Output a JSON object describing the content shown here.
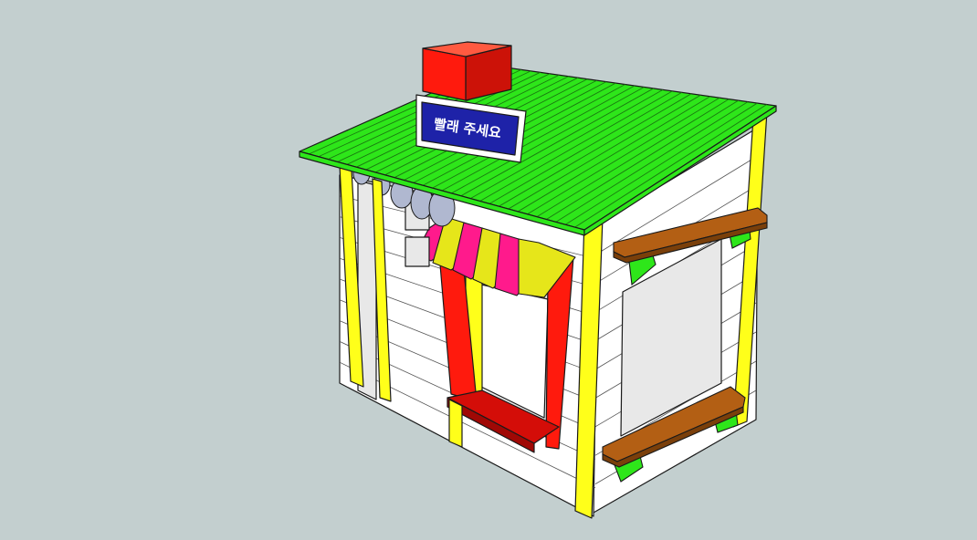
{
  "scene": {
    "background_color": "#c3cfcf",
    "outline_color": "#1a1a1a"
  },
  "roof": {
    "color": "#2ee61a",
    "plank_line_color": "#1a7a10"
  },
  "chimney": {
    "front_color": "#ff1a0d",
    "side_color": "#cc1208",
    "top_color": "#ff5a40"
  },
  "sign": {
    "board_color": "#ffffff",
    "panel_color": "#1e22a8",
    "text": "빨래 주세요",
    "text_color": "#ffffff"
  },
  "walls": {
    "color": "#ffffff",
    "shade_color": "#e8e8e8",
    "line_color": "#555555"
  },
  "posts": {
    "color": "#ffff1a"
  },
  "window": {
    "frame_red": "#ff1a0d",
    "frame_yellow": "#ffff1a",
    "counter_color": "#d40d08",
    "counter_edge_color": "#a00805"
  },
  "awning": {
    "stripe_colors": [
      "#ff1a8c",
      "#e6e61a"
    ]
  },
  "shelves": {
    "top_color": "#b35f14",
    "edge_color": "#7a3f0a",
    "bracket_color": "#2ee61a"
  },
  "plates": {
    "color": "#b0b8d0"
  }
}
